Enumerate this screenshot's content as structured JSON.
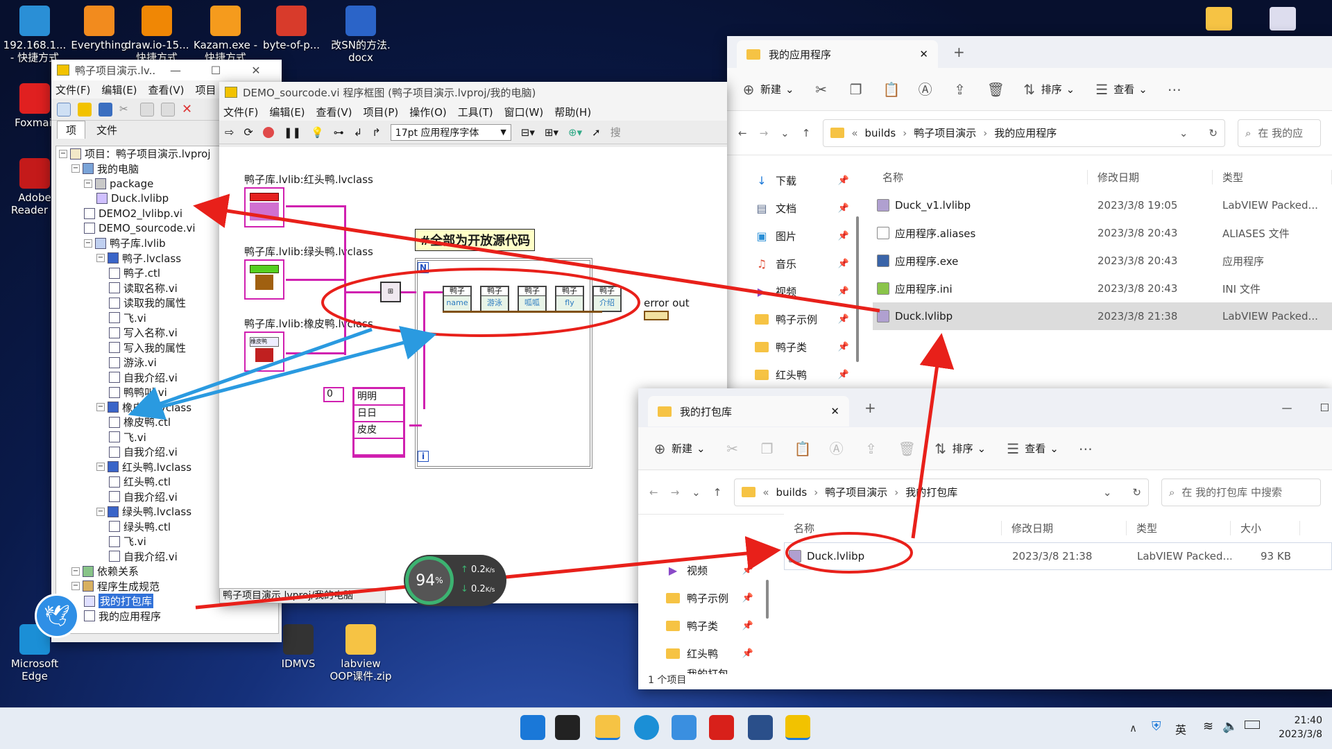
{
  "desktop": {
    "icons": [
      {
        "label": "192.168.1...\n- 快捷方式",
        "icon": "remote-desktop-icon",
        "color": "#2a8fd6"
      },
      {
        "label": "Everything",
        "icon": "search-app-icon",
        "color": "#f28b1e"
      },
      {
        "label": "draw.io-15...\n快捷方式",
        "icon": "drawio-icon",
        "color": "#f08705"
      },
      {
        "label": "Kazam.exe -\n快捷方式",
        "icon": "kazam-icon",
        "color": "#f59b1d"
      },
      {
        "label": "byte-of-p...",
        "icon": "pdf-icon",
        "color": "#d83b2b"
      },
      {
        "label": "改SN的方法.\ndocx",
        "icon": "word-icon",
        "color": "#2b64c8"
      },
      {
        "label": "Foxmail",
        "icon": "foxmail-icon",
        "color": "#e02020"
      },
      {
        "label": "Adobe\nReader X",
        "icon": "adobe-reader-icon",
        "color": "#c41a1a"
      },
      {
        "label": "Microsoft\nEdge",
        "icon": "edge-icon",
        "color": "#1b8fd6"
      },
      {
        "label": "IDMVS",
        "icon": "idmvs-icon",
        "color": "#333"
      },
      {
        "label": "labview\nOOP课件.zip",
        "icon": "zip-icon",
        "color": "#f6c344"
      }
    ]
  },
  "project_window": {
    "title": "鸭子项目演示.lv...",
    "menu": [
      "文件(F)",
      "编辑(E)",
      "查看(V)",
      "项目"
    ],
    "tabs": [
      "项",
      "文件"
    ],
    "tree": [
      {
        "label": "项目：鸭子项目演示.lvproj",
        "depth": 0
      },
      {
        "label": "我的电脑",
        "depth": 1
      },
      {
        "label": "package",
        "depth": 2
      },
      {
        "label": "Duck.lvlibp",
        "depth": 3
      },
      {
        "label": "DEMO2_lvlibp.vi",
        "depth": 2
      },
      {
        "label": "DEMO_sourcode.vi",
        "depth": 2
      },
      {
        "label": "鸭子库.lvlib",
        "depth": 2
      },
      {
        "label": "鸭子.lvclass",
        "depth": 3
      },
      {
        "label": "鸭子.ctl",
        "depth": 4
      },
      {
        "label": "读取名称.vi",
        "depth": 4
      },
      {
        "label": "读取我的属性",
        "depth": 4
      },
      {
        "label": "飞.vi",
        "depth": 4
      },
      {
        "label": "写入名称.vi",
        "depth": 4
      },
      {
        "label": "写入我的属性",
        "depth": 4
      },
      {
        "label": "游泳.vi",
        "depth": 4
      },
      {
        "label": "自我介绍.vi",
        "depth": 4
      },
      {
        "label": "鸭鸭叫.vi",
        "depth": 4
      },
      {
        "label": "橡皮鸭.lvclass",
        "depth": 3
      },
      {
        "label": "橡皮鸭.ctl",
        "depth": 4
      },
      {
        "label": "飞.vi",
        "depth": 4
      },
      {
        "label": "自我介绍.vi",
        "depth": 4
      },
      {
        "label": "红头鸭.lvclass",
        "depth": 3
      },
      {
        "label": "红头鸭.ctl",
        "depth": 4
      },
      {
        "label": "自我介绍.vi",
        "depth": 4
      },
      {
        "label": "绿头鸭.lvclass",
        "depth": 3
      },
      {
        "label": "绿头鸭.ctl",
        "depth": 4
      },
      {
        "label": "飞.vi",
        "depth": 4
      },
      {
        "label": "自我介绍.vi",
        "depth": 4
      },
      {
        "label": "依赖关系",
        "depth": 1
      },
      {
        "label": "程序生成规范",
        "depth": 1
      },
      {
        "label": "我的打包库",
        "depth": 2,
        "selected": true
      },
      {
        "label": "我的应用程序",
        "depth": 2
      }
    ]
  },
  "diagram_window": {
    "title": "DEMO_sourcode.vi 程序框图 (鸭子项目演示.lvproj/我的电脑)",
    "menu": [
      "文件(F)",
      "编辑(E)",
      "查看(V)",
      "项目(P)",
      "操作(O)",
      "工具(T)",
      "窗口(W)",
      "帮助(H)"
    ],
    "font_select": "17pt 应用程序字体",
    "search_hint": "搜",
    "class_labels": [
      "鸭子库.lvlib:红头鸭.lvclass",
      "鸭子库.lvlib:绿头鸭.lvclass",
      "鸭子库.lvlib:橡皮鸭.lvclass"
    ],
    "banner": "#全部为开放源代码",
    "loop_n": "N",
    "loop_i": "i",
    "nodes": [
      "name",
      "游泳",
      "呱呱",
      "fly",
      "介绍"
    ],
    "node_header": "鸭子",
    "error_out": "error out",
    "array_index": "0",
    "array_items": [
      "明明",
      "日日",
      "皮皮",
      ""
    ],
    "status_path": "鸭子项目演示.lvproj/我的电脑"
  },
  "explorer_app": {
    "tab_title": "我的应用程序",
    "commands": {
      "new": "新建",
      "sort": "排序",
      "view": "查看"
    },
    "breadcrumb": [
      "builds",
      "鸭子项目演示",
      "我的应用程序"
    ],
    "search_placeholder": "在 我的应",
    "nav": [
      "下载",
      "文档",
      "图片",
      "音乐",
      "视频",
      "鸭子示例",
      "鸭子类",
      "红头鸭"
    ],
    "columns": [
      "名称",
      "修改日期",
      "类型"
    ],
    "files": [
      {
        "name": "Duck_v1.lvlibp",
        "date": "2023/3/8 19:05",
        "type": "LabVIEW Packed..."
      },
      {
        "name": "应用程序.aliases",
        "date": "2023/3/8 20:43",
        "type": "ALIASES 文件"
      },
      {
        "name": "应用程序.exe",
        "date": "2023/3/8 20:43",
        "type": "应用程序"
      },
      {
        "name": "应用程序.ini",
        "date": "2023/3/8 20:43",
        "type": "INI 文件"
      },
      {
        "name": "Duck.lvlibp",
        "date": "2023/3/8 21:38",
        "type": "LabVIEW Packed..."
      }
    ]
  },
  "explorer_pkg": {
    "tab_title": "我的打包库",
    "commands": {
      "new": "新建",
      "sort": "排序",
      "view": "查看"
    },
    "breadcrumb": [
      "builds",
      "鸭子项目演示",
      "我的打包库"
    ],
    "search_placeholder": "在 我的打包库 中搜索",
    "nav": [
      "视频",
      "鸭子示例",
      "鸭子类",
      "红头鸭",
      "我的打包库"
    ],
    "columns": [
      "名称",
      "修改日期",
      "类型",
      "大小"
    ],
    "files": [
      {
        "name": "Duck.lvlibp",
        "date": "2023/3/8 21:38",
        "type": "LabVIEW Packed...",
        "size": "93 KB"
      }
    ],
    "status": "1 个项目"
  },
  "speed_widget": {
    "percent": "94",
    "unit": "%",
    "up": "0.2",
    "down": "0.2",
    "rate_unit": "K/s"
  },
  "taskbar": {
    "ime": "英",
    "time": "21:40",
    "date": "2023/3/8"
  },
  "colors": {
    "annotation_red": "#e8201a",
    "annotation_blue": "#2a9ae0",
    "lv_pink": "#d020b0"
  }
}
